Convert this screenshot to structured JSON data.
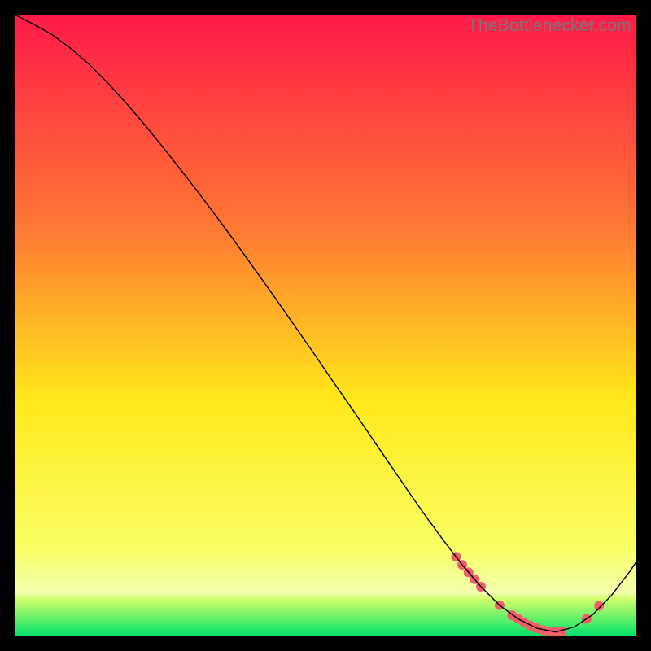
{
  "watermark": "TheBottlenecker.com",
  "chart_data": {
    "type": "line",
    "title": "",
    "xlabel": "",
    "ylabel": "",
    "xlim": [
      0,
      100
    ],
    "ylim": [
      0,
      100
    ],
    "grid": false,
    "background_gradient": {
      "top_color": "#ff1a49",
      "mid_upper_color": "#ff7a33",
      "mid_color": "#ffe91a",
      "mid_lower_color": "#faff66",
      "green_band_top": "#d0ff6a",
      "green_band_bottom": "#00e26a",
      "green_band_start_y": 6,
      "green_band_end_y": 0
    },
    "series": [
      {
        "name": "bottleneck-curve",
        "color": "#000000",
        "stroke_width": 1.4,
        "x": [
          0,
          3,
          6,
          9,
          12,
          15,
          18,
          21,
          24,
          27,
          30,
          33,
          36,
          39,
          42,
          45,
          48,
          51,
          54,
          57,
          60,
          63,
          66,
          69,
          72,
          75,
          78,
          81,
          84,
          87,
          90,
          93,
          96,
          99,
          100
        ],
        "y": [
          100,
          98.5,
          96.8,
          94.6,
          92.0,
          89.0,
          85.7,
          82.2,
          78.5,
          74.7,
          70.8,
          66.8,
          62.7,
          58.5,
          54.3,
          50.0,
          45.7,
          41.3,
          37.0,
          32.6,
          28.2,
          23.8,
          19.5,
          15.4,
          11.5,
          8.0,
          5.0,
          2.8,
          1.3,
          0.7,
          1.5,
          3.5,
          6.6,
          10.5,
          12.0
        ]
      }
    ],
    "markers": {
      "name": "highlighted-points",
      "color": "#f25d6a",
      "radius": 6,
      "x": [
        71,
        72,
        73,
        74,
        75,
        78,
        80,
        81,
        82,
        83,
        84,
        85,
        86,
        87,
        88,
        92,
        94
      ],
      "y": [
        12.8,
        11.5,
        10.3,
        9.2,
        8.0,
        5.0,
        3.4,
        2.8,
        2.2,
        1.7,
        1.3,
        1.0,
        0.8,
        0.7,
        0.8,
        2.8,
        4.9
      ]
    }
  }
}
